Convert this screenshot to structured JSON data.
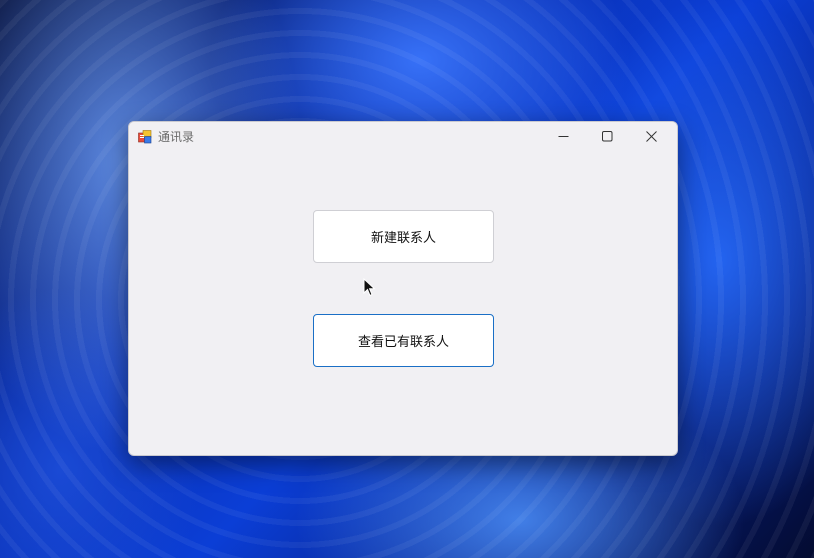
{
  "window": {
    "title": "通讯录",
    "icon": "app-icon",
    "controls": {
      "minimize": "minimize-icon",
      "maximize": "maximize-icon",
      "close": "close-icon"
    }
  },
  "main": {
    "buttons": {
      "new_contact": "新建联系人",
      "view_contacts": "查看已有联系人"
    }
  },
  "colors": {
    "window_bg": "#f1f0f3",
    "button_bg": "#ffffff",
    "focused_border": "#1a6fc6"
  }
}
